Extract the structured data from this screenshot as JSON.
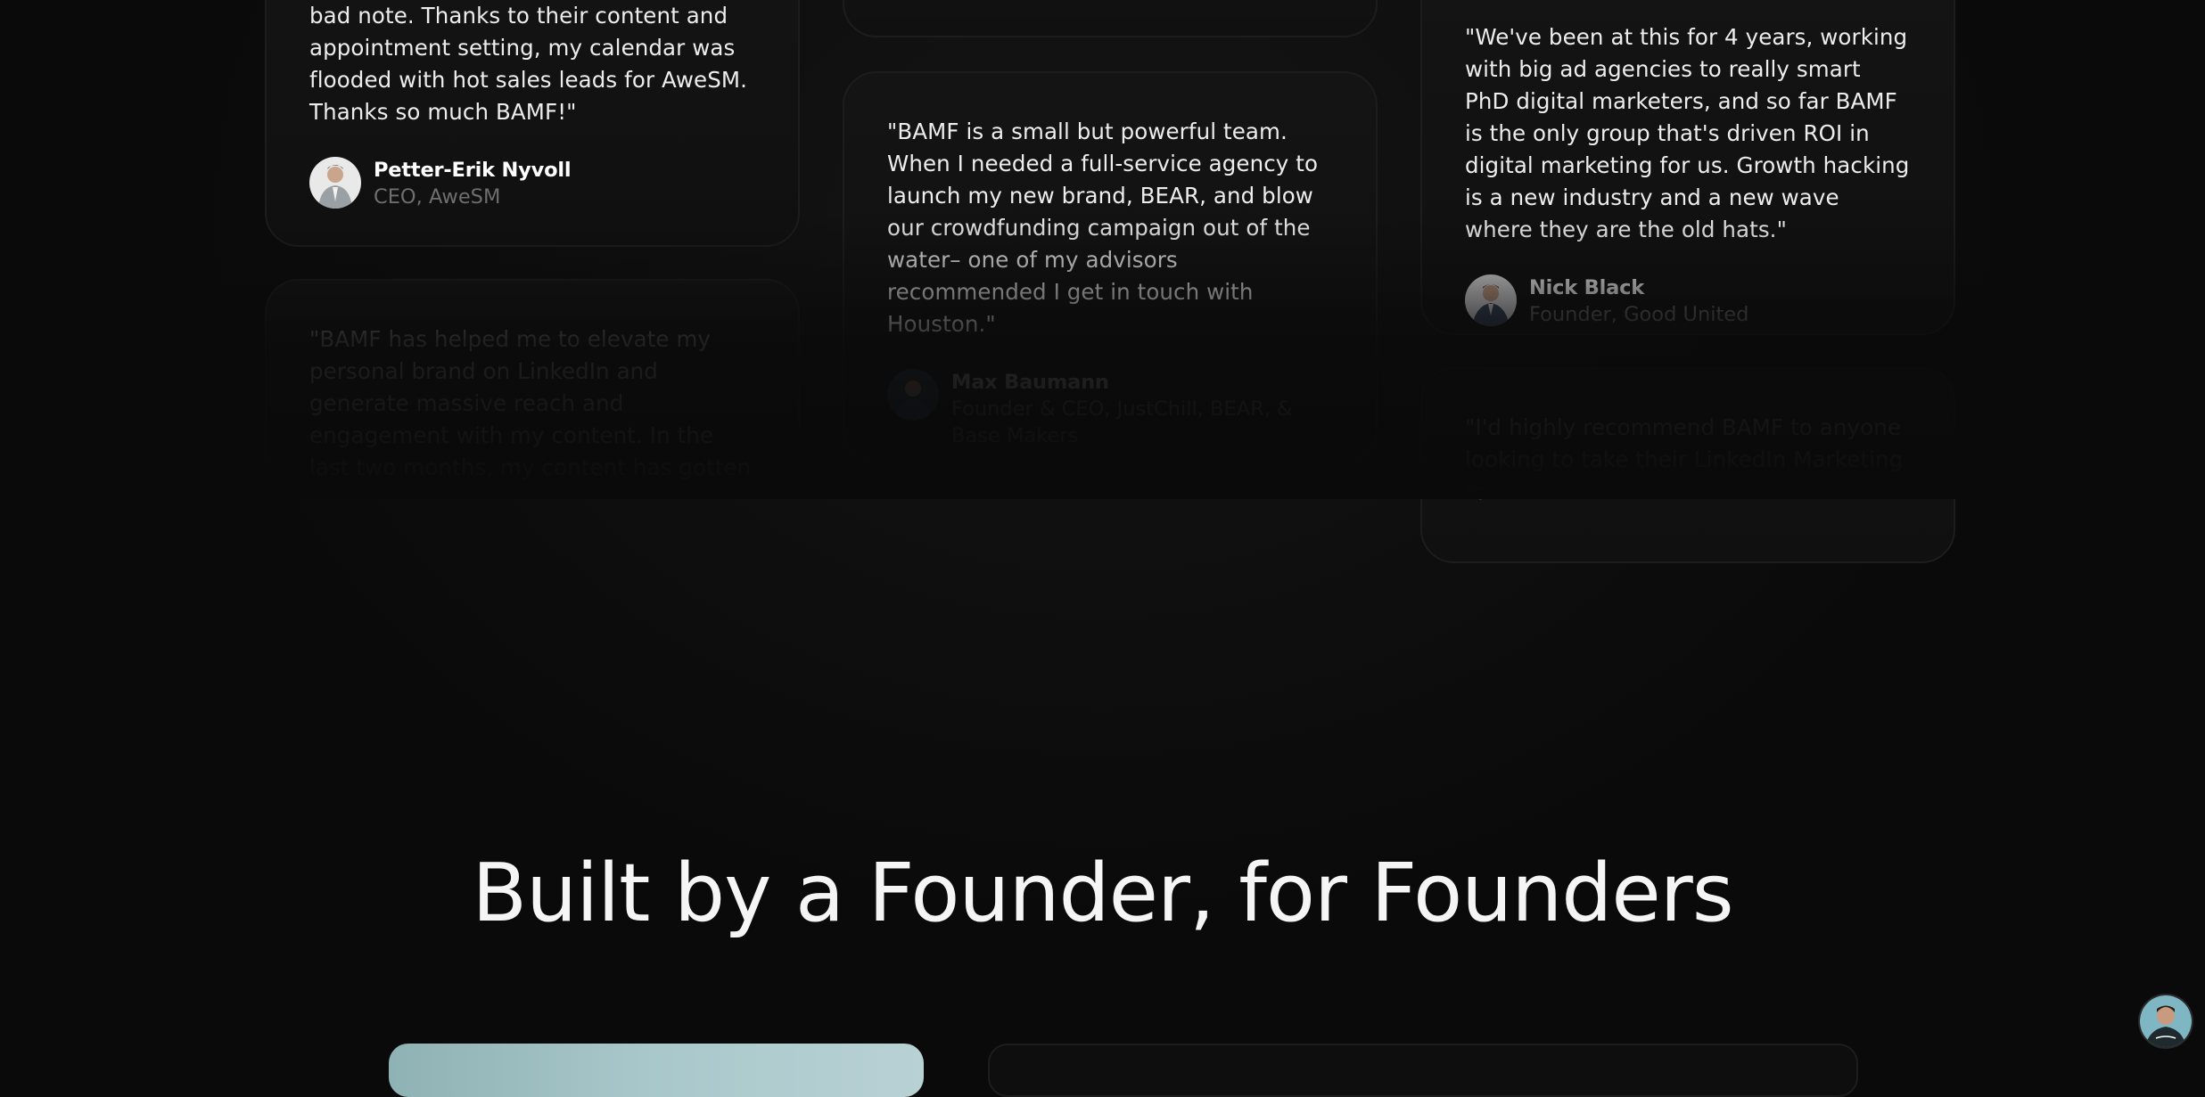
{
  "testimonials": {
    "col1": [
      {
        "quote": "bad note. Thanks to their content and appointment setting, my calendar was flooded with hot sales leads for AweSM. Thanks so much BAMF!\"",
        "name": "Petter-Erik Nyvoll",
        "role": "CEO, AweSM",
        "avatar_icon": "person-avatar-icon"
      },
      {
        "quote": "\"BAMF has helped me to elevate my personal brand on LinkedIn and generate massive reach and engagement with my content. In the last two months, my content has gotten"
      }
    ],
    "col2": [
      {
        "quote": "\"BAMF is a small but powerful team. When I needed a full-service agency to launch my new brand, BEAR, and blow our crowdfunding campaign out of the water– one of my advisors recommended I get in touch with Houston.\"",
        "name": "Max Baumann",
        "role": "Founder & CEO, JustChill, BEAR, & Base Makers",
        "avatar_icon": "person-avatar-icon"
      }
    ],
    "col3": [
      {
        "quote": "\"We've been at this for 4 years, working with big ad agencies to really smart PhD digital marketers, and so far BAMF is the only group that's driven ROI in digital marketing for us. Growth hacking is a new industry and a new wave where they are the old hats.\"",
        "name": "Nick Black",
        "role": "Founder, Good United",
        "avatar_icon": "person-avatar-icon"
      },
      {
        "quote": "\"I'd highly recommend BAMF to anyone looking to take their LinkedIn Marketing to"
      }
    ]
  },
  "founders_section": {
    "title": "Built by a Founder, for Founders"
  },
  "chat_launcher": {
    "icon": "founder-avatar-icon"
  },
  "colors": {
    "background": "#0a0a0a",
    "card_border": "#1d1d1d",
    "muted_text": "#6e6e6e"
  }
}
